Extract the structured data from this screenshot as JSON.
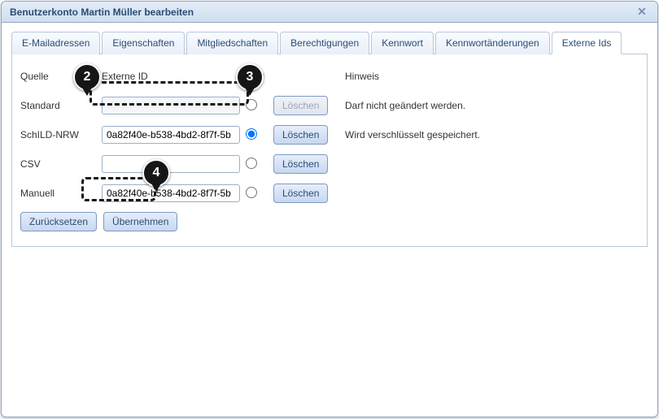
{
  "window": {
    "title": "Benutzerkonto Martin Müller bearbeiten"
  },
  "tabs": [
    {
      "label": "E-Mailadressen"
    },
    {
      "label": "Eigenschaften"
    },
    {
      "label": "Mitgliedschaften"
    },
    {
      "label": "Berechtigungen"
    },
    {
      "label": "Kennwort"
    },
    {
      "label": "Kennwortänderungen"
    },
    {
      "label": "Externe Ids",
      "active": true
    }
  ],
  "headers": {
    "source": "Quelle",
    "external_id": "Externe ID",
    "active": "aktiv",
    "hint": "Hinweis"
  },
  "rows": [
    {
      "source": "Standard",
      "id": "",
      "delete": "Löschen",
      "delete_disabled": true,
      "hint": "Darf nicht geändert werden.",
      "active": false
    },
    {
      "source": "SchILD-NRW",
      "id": "0a82f40e-b538-4bd2-8f7f-5b",
      "delete": "Löschen",
      "delete_disabled": false,
      "hint": "Wird verschlüsselt gespeichert.",
      "active": true
    },
    {
      "source": "CSV",
      "id": "",
      "delete": "Löschen",
      "delete_disabled": false,
      "hint": "",
      "active": false
    },
    {
      "source": "Manuell",
      "id": "0a82f40e-b538-4bd2-8f7f-5b",
      "delete": "Löschen",
      "delete_disabled": false,
      "hint": "",
      "active": false
    }
  ],
  "buttons": {
    "reset": "Zurücksetzen",
    "apply": "Übernehmen"
  },
  "callouts": {
    "c2": "2",
    "c3": "3",
    "c4": "4"
  }
}
